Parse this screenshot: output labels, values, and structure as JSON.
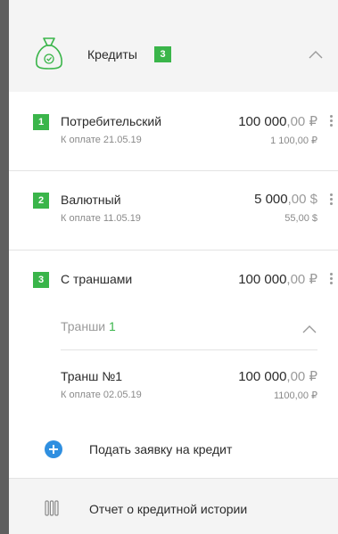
{
  "header": {
    "title": "Кредиты",
    "count": "3"
  },
  "loans": [
    {
      "index": "1",
      "name": "Потребительский",
      "amount_int": "100 000",
      "amount_frac": ",00 ₽",
      "due": "К оплате 21.05.19",
      "payment": "1 100,00 ₽"
    },
    {
      "index": "2",
      "name": "Валютный",
      "amount_int": "5 000",
      "amount_frac": ",00 $",
      "due": "К оплате 11.05.19",
      "payment": "55,00 $"
    },
    {
      "index": "3",
      "name": "С траншами",
      "amount_int": "100 000",
      "amount_frac": ",00 ₽"
    }
  ],
  "tranches": {
    "label": "Транши",
    "count": "1",
    "items": [
      {
        "name": "Транш №1",
        "amount_int": "100 000",
        "amount_frac": ",00 ₽",
        "due": "К оплате 02.05.19",
        "payment": "1100,00 ₽"
      }
    ]
  },
  "actions": {
    "apply_label": "Подать заявку на кредит",
    "report_label": "Отчет о кредитной истории"
  },
  "colors": {
    "accent_green": "#3ab54a",
    "accent_blue": "#2f8fe0"
  }
}
